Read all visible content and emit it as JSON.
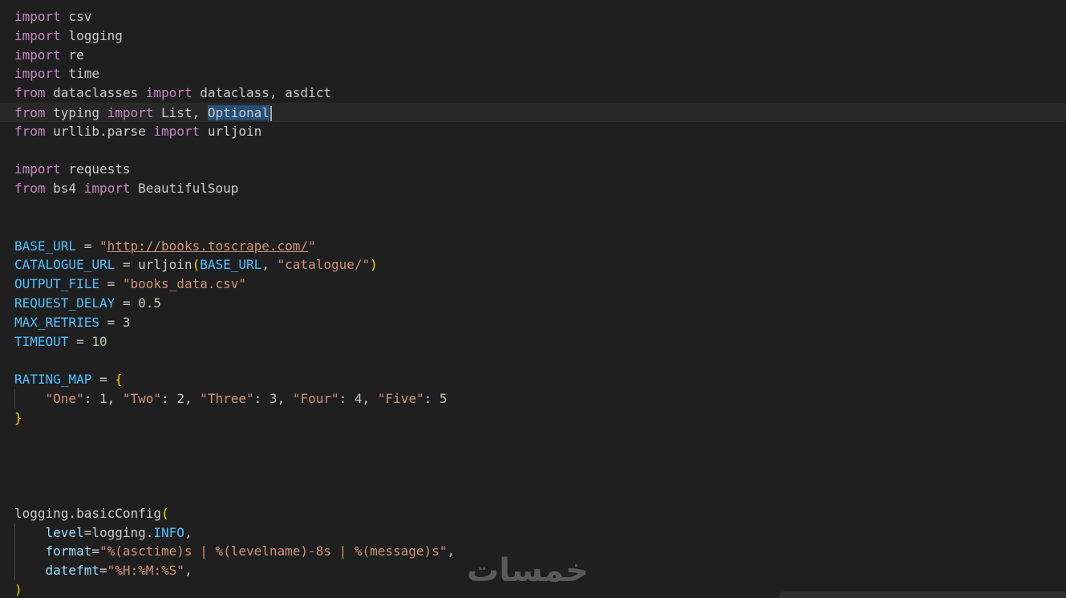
{
  "editor": {
    "lines": [
      [
        {
          "t": "import",
          "c": "kw"
        },
        {
          "t": " csv",
          "c": "mod"
        }
      ],
      [
        {
          "t": "import",
          "c": "kw"
        },
        {
          "t": " logging",
          "c": "mod"
        }
      ],
      [
        {
          "t": "import",
          "c": "kw"
        },
        {
          "t": " re",
          "c": "mod"
        }
      ],
      [
        {
          "t": "import",
          "c": "kw"
        },
        {
          "t": " time",
          "c": "mod"
        }
      ],
      [
        {
          "t": "from",
          "c": "kw"
        },
        {
          "t": " dataclasses ",
          "c": "mod"
        },
        {
          "t": "import",
          "c": "kw"
        },
        {
          "t": " dataclass, asdict",
          "c": "mod"
        }
      ],
      [
        {
          "t": "from",
          "c": "kw"
        },
        {
          "t": " typing ",
          "c": "mod"
        },
        {
          "t": "import",
          "c": "kw"
        },
        {
          "t": " List, ",
          "c": "mod"
        },
        {
          "t": "Optional",
          "c": "mod sel"
        }
      ],
      [
        {
          "t": "from",
          "c": "kw"
        },
        {
          "t": " urllib.parse ",
          "c": "mod"
        },
        {
          "t": "import",
          "c": "kw"
        },
        {
          "t": " urljoin",
          "c": "mod"
        }
      ],
      [],
      [
        {
          "t": "import",
          "c": "kw"
        },
        {
          "t": " requests",
          "c": "mod"
        }
      ],
      [
        {
          "t": "from",
          "c": "kw"
        },
        {
          "t": " bs4 ",
          "c": "mod"
        },
        {
          "t": "import",
          "c": "kw"
        },
        {
          "t": " BeautifulSoup",
          "c": "mod"
        }
      ],
      [],
      [],
      [
        {
          "t": "BASE_URL",
          "c": "const"
        },
        {
          "t": " = ",
          "c": "mod"
        },
        {
          "t": "\"",
          "c": "str"
        },
        {
          "t": "http://books.toscrape.com/",
          "c": "str url"
        },
        {
          "t": "\"",
          "c": "str"
        }
      ],
      [
        {
          "t": "CATALOGUE_URL",
          "c": "const"
        },
        {
          "t": " = urljoin",
          "c": "mod"
        },
        {
          "t": "(",
          "c": "br1"
        },
        {
          "t": "BASE_URL",
          "c": "const"
        },
        {
          "t": ", ",
          "c": "mod"
        },
        {
          "t": "\"catalogue/\"",
          "c": "str"
        },
        {
          "t": ")",
          "c": "br1"
        }
      ],
      [
        {
          "t": "OUTPUT_FILE",
          "c": "const"
        },
        {
          "t": " = ",
          "c": "mod"
        },
        {
          "t": "\"books_data.csv\"",
          "c": "str"
        }
      ],
      [
        {
          "t": "REQUEST_DELAY",
          "c": "const"
        },
        {
          "t": " = ",
          "c": "mod"
        },
        {
          "t": "0.5",
          "c": "num"
        }
      ],
      [
        {
          "t": "MAX_RETRIES",
          "c": "const"
        },
        {
          "t": " = ",
          "c": "mod"
        },
        {
          "t": "3",
          "c": "num"
        }
      ],
      [
        {
          "t": "TIMEOUT",
          "c": "const"
        },
        {
          "t": " = ",
          "c": "mod"
        },
        {
          "t": "10",
          "c": "num"
        }
      ],
      [],
      [
        {
          "t": "RATING_MAP",
          "c": "const"
        },
        {
          "t": " = ",
          "c": "mod"
        },
        {
          "t": "{",
          "c": "br1"
        }
      ],
      [
        {
          "t": "    ",
          "c": "mod"
        },
        {
          "t": "\"One\"",
          "c": "str"
        },
        {
          "t": ": ",
          "c": "mod"
        },
        {
          "t": "1",
          "c": "num"
        },
        {
          "t": ", ",
          "c": "mod"
        },
        {
          "t": "\"Two\"",
          "c": "str"
        },
        {
          "t": ": ",
          "c": "mod"
        },
        {
          "t": "2",
          "c": "num"
        },
        {
          "t": ", ",
          "c": "mod"
        },
        {
          "t": "\"Three\"",
          "c": "str"
        },
        {
          "t": ": ",
          "c": "mod"
        },
        {
          "t": "3",
          "c": "num"
        },
        {
          "t": ", ",
          "c": "mod"
        },
        {
          "t": "\"Four\"",
          "c": "str"
        },
        {
          "t": ": ",
          "c": "mod"
        },
        {
          "t": "4",
          "c": "num"
        },
        {
          "t": ", ",
          "c": "mod"
        },
        {
          "t": "\"Five\"",
          "c": "str"
        },
        {
          "t": ": ",
          "c": "mod"
        },
        {
          "t": "5",
          "c": "num"
        }
      ],
      [
        {
          "t": "}",
          "c": "br1"
        }
      ],
      [],
      [],
      [],
      [],
      [
        {
          "t": "logging.basicConfig",
          "c": "mod"
        },
        {
          "t": "(",
          "c": "br1"
        }
      ],
      [
        {
          "t": "    ",
          "c": "mod"
        },
        {
          "t": "level",
          "c": "param"
        },
        {
          "t": "=logging.",
          "c": "mod"
        },
        {
          "t": "INFO",
          "c": "const"
        },
        {
          "t": ",",
          "c": "mod"
        }
      ],
      [
        {
          "t": "    ",
          "c": "mod"
        },
        {
          "t": "format",
          "c": "param"
        },
        {
          "t": "=",
          "c": "mod"
        },
        {
          "t": "\"%(asctime)s | %(levelname)-8s | %(message)s\"",
          "c": "str"
        },
        {
          "t": ",",
          "c": "mod"
        }
      ],
      [
        {
          "t": "    ",
          "c": "mod"
        },
        {
          "t": "datefmt",
          "c": "param"
        },
        {
          "t": "=",
          "c": "mod"
        },
        {
          "t": "\"%H:%M:%S\"",
          "c": "str"
        },
        {
          "t": ",",
          "c": "mod"
        }
      ],
      [
        {
          "t": ")",
          "c": "br1"
        }
      ]
    ],
    "current_line_index": 5,
    "cursor_after_token": "Optional"
  },
  "watermark": {
    "text": "خمسات"
  }
}
